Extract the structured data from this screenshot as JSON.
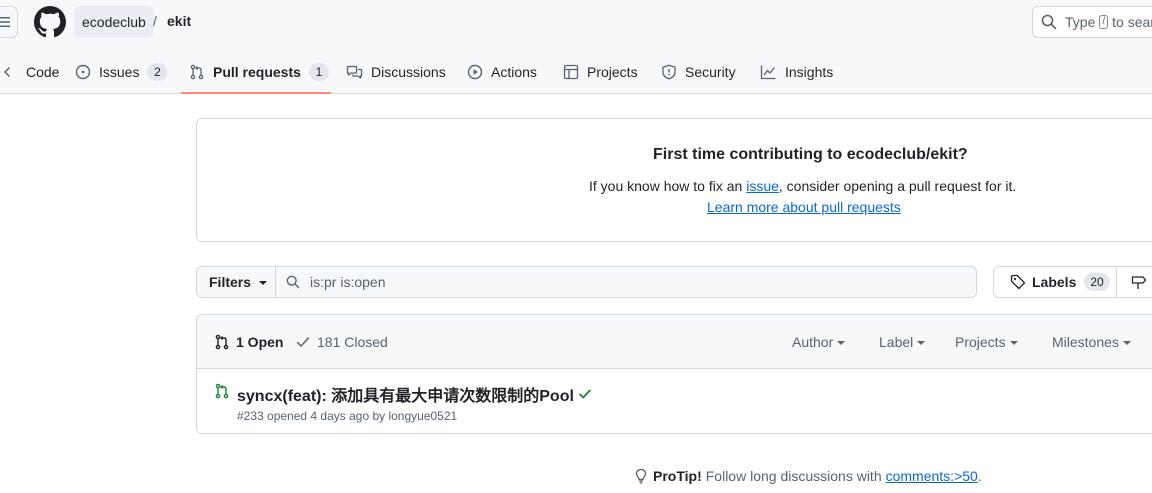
{
  "header": {
    "owner": "ecodeclub",
    "separator": "/",
    "repo": "ekit",
    "search": {
      "prefix": "Type",
      "key": "/",
      "suffix": "to search"
    }
  },
  "tabs": [
    {
      "label": "Code",
      "icon": "code-icon"
    },
    {
      "label": "Issues",
      "icon": "issue-opened-icon",
      "count": "2"
    },
    {
      "label": "Pull requests",
      "icon": "git-pull-request-icon",
      "count": "1",
      "active": true
    },
    {
      "label": "Discussions",
      "icon": "comment-discussion-icon"
    },
    {
      "label": "Actions",
      "icon": "play-icon"
    },
    {
      "label": "Projects",
      "icon": "table-icon"
    },
    {
      "label": "Security",
      "icon": "shield-icon"
    },
    {
      "label": "Insights",
      "icon": "graph-icon"
    }
  ],
  "contributing": {
    "title": "First time contributing to ecodeclub/ekit?",
    "text_before": "If you know how to fix an ",
    "issue_link": "issue",
    "text_after": ", consider opening a pull request for it.",
    "learn_link": "Learn more about pull requests"
  },
  "filters": {
    "button_label": "Filters",
    "query": "is:pr is:open",
    "labels_label": "Labels",
    "labels_count": "20"
  },
  "list": {
    "open_label": "1 Open",
    "closed_label": "181 Closed",
    "selectors": [
      "Author",
      "Label",
      "Projects",
      "Milestones"
    ],
    "items": [
      {
        "title": "syncx(feat): 添加具有最大申请次数限制的Pool",
        "meta": "#233 opened 4 days ago by longyue0521",
        "status": "success"
      }
    ]
  },
  "protip": {
    "label": "ProTip!",
    "text": "Follow long discussions with",
    "link": "comments:>50",
    "end": "."
  },
  "colors": {
    "accent_underline": "#fd8c73",
    "link": "#0969da",
    "open_green": "#1a7f37"
  }
}
